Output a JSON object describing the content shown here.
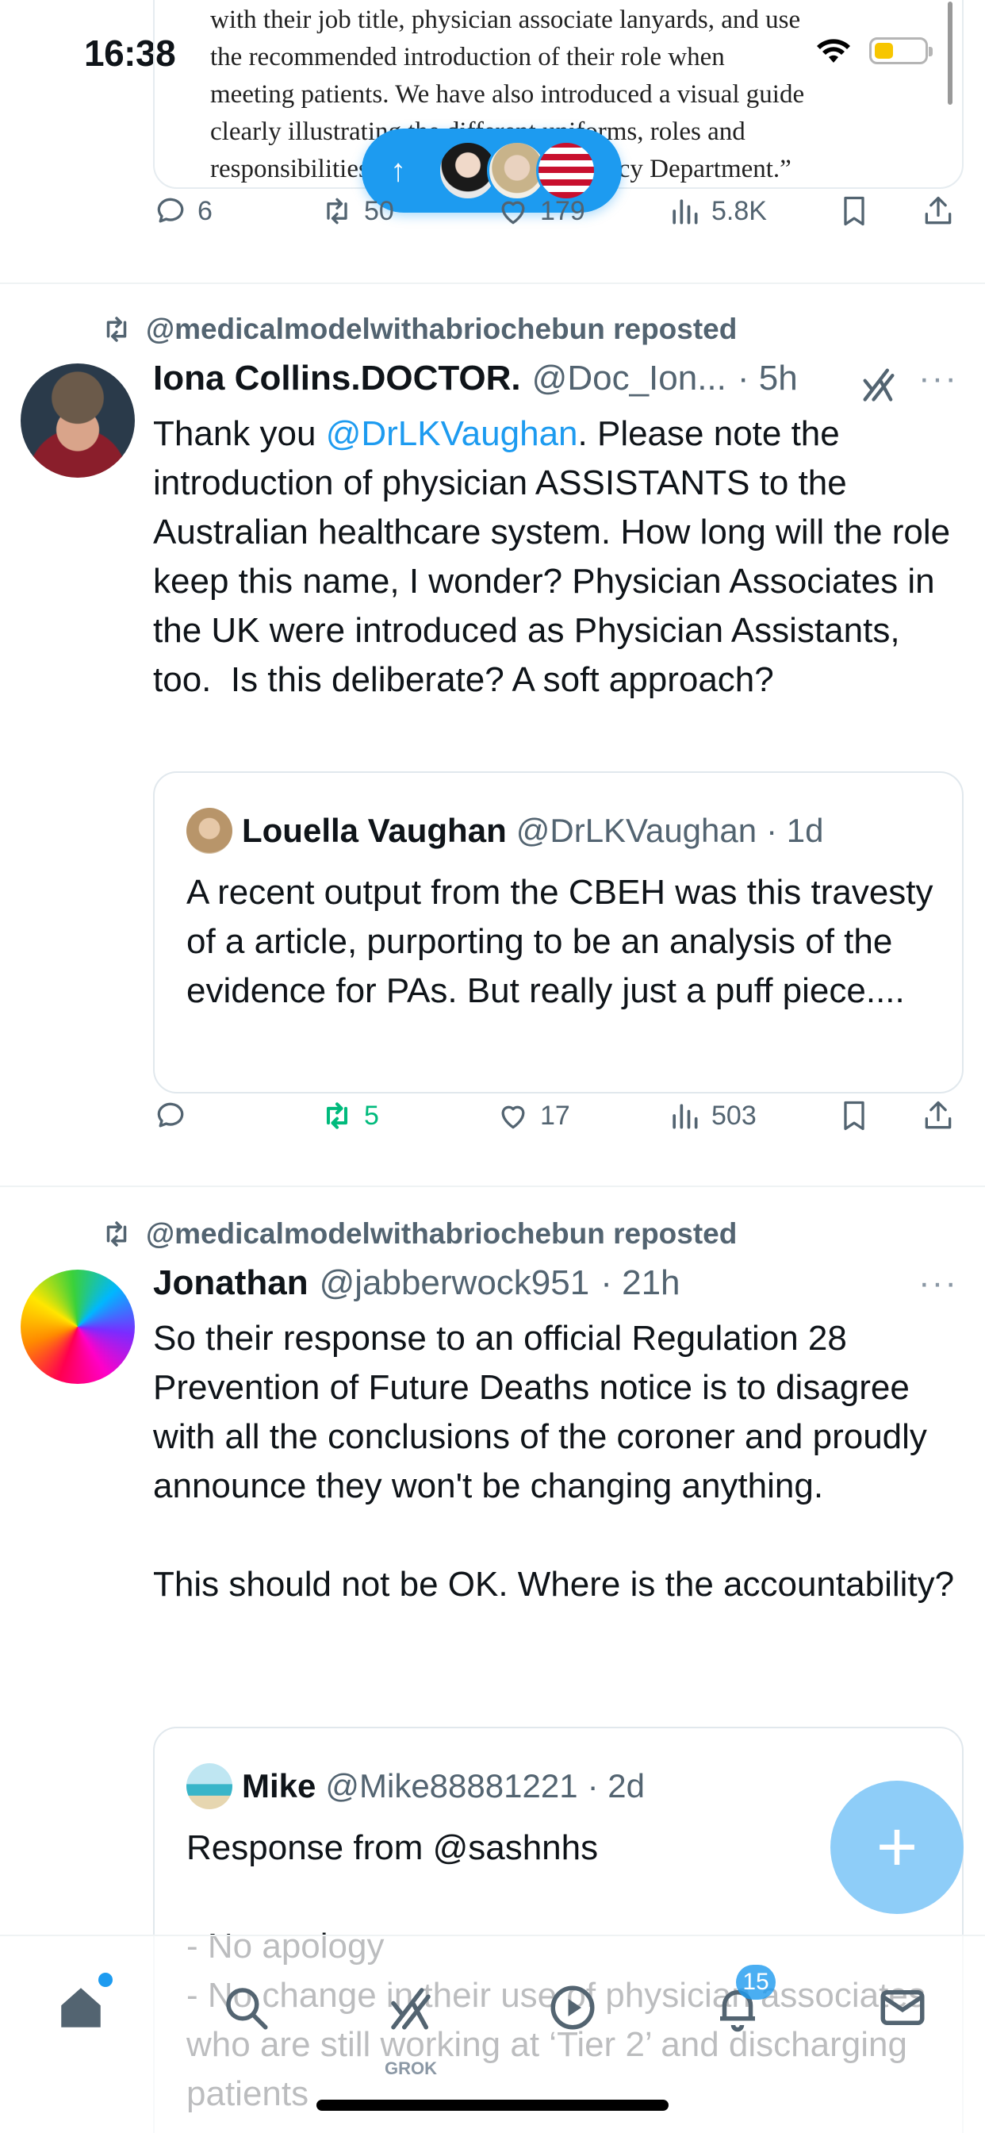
{
  "status_bar": {
    "time": "16:38"
  },
  "top_quote": {
    "lines": [
      "with their job title, physician associate lanyards, and use",
      "the recommended introduction of their role when",
      "meeting patients. We have also introduced a visual guide",
      "clearly illustrating the different uniforms, roles and",
      "responsibilities of staff in our Emergency Department.”"
    ]
  },
  "new_posts_pill": {
    "arrow": "↑"
  },
  "post0_actions": {
    "replies": "6",
    "reposts": "50",
    "likes": "179",
    "views": "5.8K"
  },
  "posts": [
    {
      "repost_label": "@medicalmodelwithabriochebun reposted",
      "name": "Iona Collins.DOCTOR.",
      "handle": "@Doc_Ion...",
      "time": "· 5h",
      "more": "···",
      "body_prefix": "Thank you ",
      "mention": "@DrLKVaughan",
      "body_suffix": ". Please note the introduction of physician ASSISTANTS to the Australian healthcare system. How long will the role keep this name, I wonder? Physician Associates in the UK were introduced as Physician Assistants, too.  Is this deliberate? A soft approach?",
      "quote": {
        "name": "Louella Vaughan",
        "handle": "@DrLKVaughan",
        "time": "· 1d",
        "body": "A recent output from the CBEH was this travesty of a article, purporting to be an analysis of the evidence for PAs. But really just a puff piece...."
      },
      "actions": {
        "replies": "",
        "reposts": "5",
        "likes": "17",
        "views": "503"
      }
    },
    {
      "repost_label": "@medicalmodelwithabriochebun reposted",
      "name": "Jonathan",
      "handle": "@jabberwock951",
      "time": "· 21h",
      "more": "···",
      "body": "So their response to an official Regulation 28 Prevention of Future Deaths notice is to disagree with all the conclusions of the coroner and proudly announce they won't be changing anything.\n\nThis should not be OK. Where is the accountability?",
      "quote": {
        "name": "Mike",
        "handle": "@Mike88881221",
        "time": "· 2d",
        "body": "Response from @sashnhs\n\n- No apology\n- No change in their use of physician associates who are still working at ‘Tier 2’ and discharging patients"
      }
    }
  ],
  "fab": {
    "label": "+"
  },
  "bottom_nav": {
    "grok_label": "GROK",
    "notifications_badge": "15"
  },
  "colors": {
    "accent": "#1d9bf0",
    "repost_green": "#00ba7c",
    "muted": "#536471"
  }
}
